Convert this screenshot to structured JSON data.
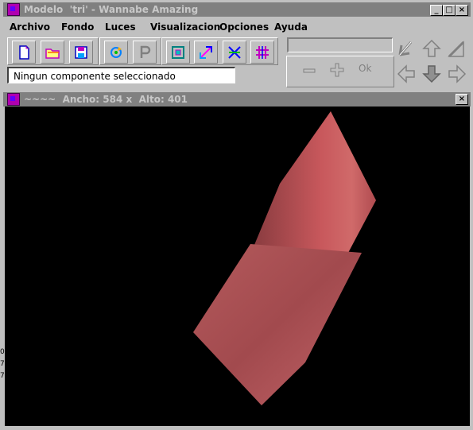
{
  "window": {
    "title": "Modelo  'tri' - Wannabe Amazing",
    "minimize_label": "_",
    "maximize_label": "□",
    "close_label": "×"
  },
  "menu": {
    "items": [
      "Archivo",
      "Fondo",
      "Luces",
      "Visualizacion",
      "Opciones",
      "Ayuda"
    ]
  },
  "toolbar": {
    "groups": [
      [
        "new-file-icon",
        "open-folder-icon",
        "save-icon"
      ],
      [
        "rotate-icon",
        "perspective-p-icon"
      ],
      [
        "frame-icon",
        "scale-icon",
        "translate-xyz-icon",
        "grid-icon"
      ]
    ]
  },
  "status": {
    "text": "Ningun componente seleccionado"
  },
  "component_input": {
    "value": ""
  },
  "controls": {
    "minus_label": "−",
    "plus_label": "+",
    "ok_label": "Ok"
  },
  "navigation": {
    "icons": [
      "up-left-arrow-icon",
      "up-arrow-icon",
      "up-right-arrow-icon",
      "left-arrow-icon",
      "down-arrow-icon",
      "right-arrow-icon"
    ]
  },
  "viewport": {
    "title": "~~~~  Ancho: 584 x  Alto: 401",
    "close_label": "×",
    "background": "#000000",
    "model_color": "#c86060"
  },
  "edge_fragments": [
    "0",
    "7",
    "7"
  ]
}
